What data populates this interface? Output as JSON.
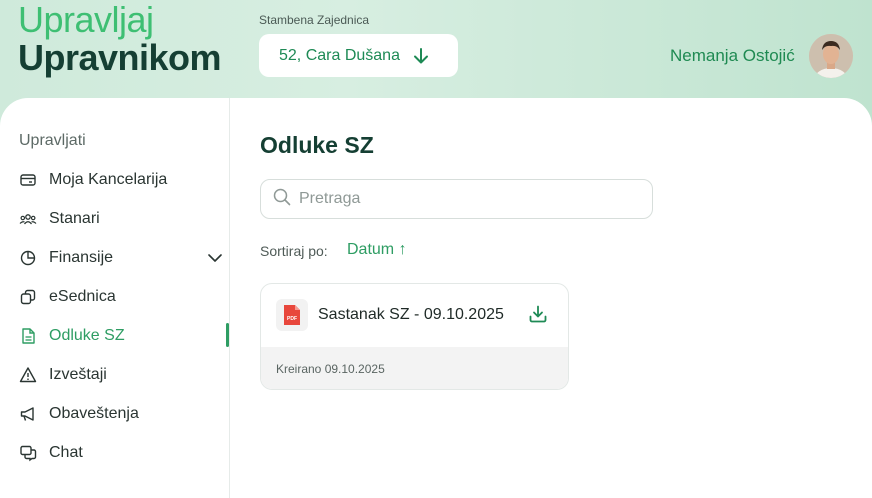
{
  "logo": {
    "line1": "Upravljaj",
    "line2": "Upravnikom"
  },
  "community": {
    "label": "Stambena Zajednica",
    "selected": "52, Cara Dušana"
  },
  "user": {
    "name": "Nemanja Ostojić"
  },
  "sidebar": {
    "heading": "Upravljati",
    "items": [
      {
        "label": "Moja Kancelarija",
        "icon": "wallet-icon"
      },
      {
        "label": "Stanari",
        "icon": "users-icon"
      },
      {
        "label": "Finansije",
        "icon": "pie-chart-icon"
      },
      {
        "label": "eSednica",
        "icon": "copy-icon"
      },
      {
        "label": "Odluke SZ",
        "icon": "document-icon"
      },
      {
        "label": "Izveštaji",
        "icon": "warning-icon"
      },
      {
        "label": "Obaveštenja",
        "icon": "megaphone-icon"
      },
      {
        "label": "Chat",
        "icon": "chat-icon"
      }
    ],
    "active_index": 4
  },
  "main": {
    "title": "Odluke SZ",
    "search_placeholder": "Pretraga",
    "sort_label": "Sortiraj po:",
    "sort_value": "Datum ↑",
    "documents": [
      {
        "title": "Sastanak SZ - 09.10.2025",
        "created": "Kreirano 09.10.2025",
        "file_badge": "PDF"
      }
    ]
  },
  "colors": {
    "accent": "#2e9d63",
    "dark": "#153f33",
    "logo_light": "#3ebf73"
  }
}
